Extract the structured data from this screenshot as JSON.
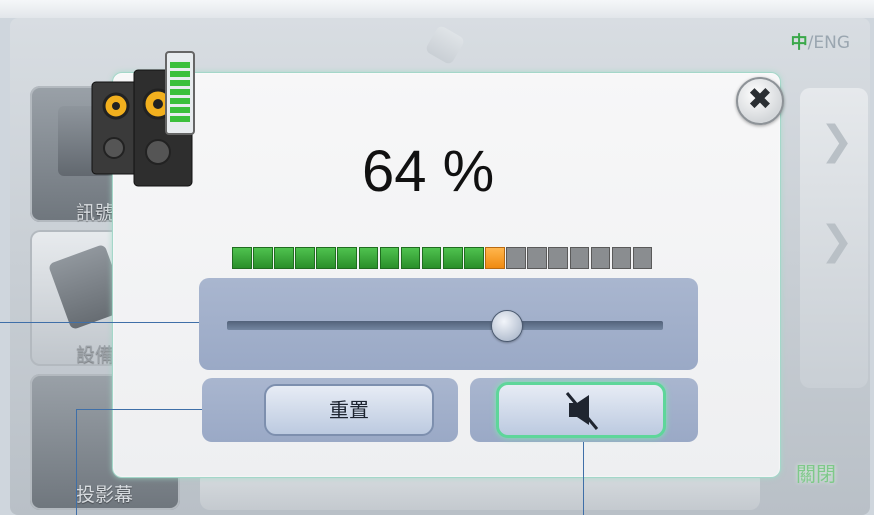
{
  "header": {
    "lang_active": "中",
    "lang_separator": "/",
    "lang_other": "ENG"
  },
  "sidebar": {
    "items": [
      {
        "label": "訊號"
      },
      {
        "label": "設備"
      },
      {
        "label": "投影幕"
      }
    ]
  },
  "footer": {
    "close_label": "關閉"
  },
  "volume_dialog": {
    "percent_text": "64 %",
    "volume_fraction": 0.64,
    "level_segments_total": 20,
    "level_segments_on": 12,
    "reset_label": "重置",
    "icons": {
      "speaker": "speakers-volume-icon",
      "close": "close-icon",
      "mute": "speaker-mute-icon"
    },
    "colors": {
      "segment_on": "#36a936",
      "segment_current": "#f59a1e",
      "segment_off": "#8a8d90",
      "mute_glow": "#5ed69a"
    }
  }
}
